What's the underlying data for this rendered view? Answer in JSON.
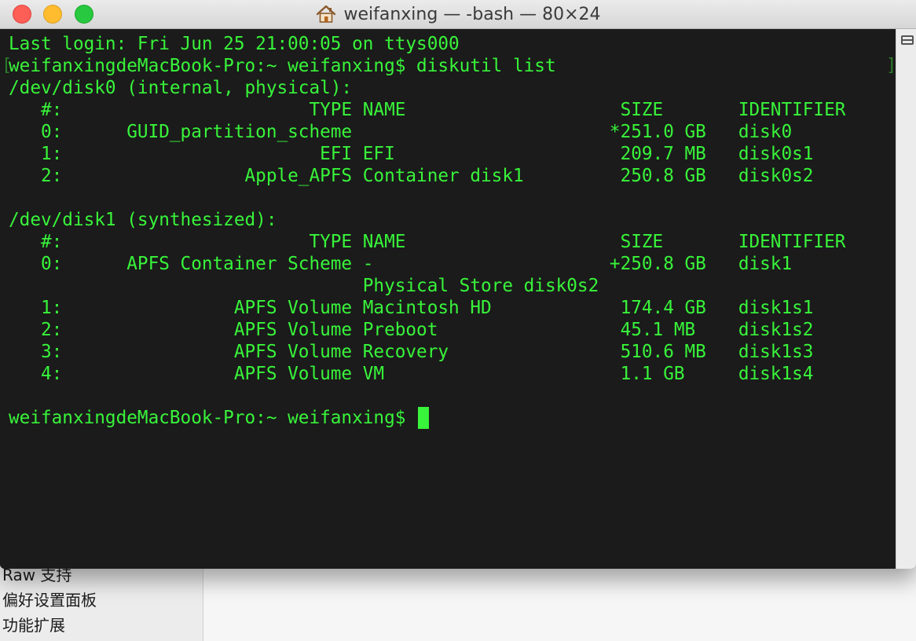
{
  "window": {
    "title": "weifanxing — -bash — 80×24",
    "title_icon": "home-icon"
  },
  "terminal": {
    "lines": [
      "Last login: Fri Jun 25 21:00:05 on ttys000",
      "weifanxingdeMacBook-Pro:~ weifanxing$ diskutil list",
      "/dev/disk0 (internal, physical):",
      "   #:                       TYPE NAME                    SIZE       IDENTIFIER",
      "   0:      GUID_partition_scheme                        *251.0 GB   disk0",
      "   1:                        EFI EFI                     209.7 MB   disk0s1",
      "   2:                 Apple_APFS Container disk1         250.8 GB   disk0s2",
      "",
      "/dev/disk1 (synthesized):",
      "   #:                       TYPE NAME                    SIZE       IDENTIFIER",
      "   0:      APFS Container Scheme -                      +250.8 GB   disk1",
      "                                 Physical Store disk0s2",
      "   1:                APFS Volume Macintosh HD            174.4 GB   disk1s1",
      "   2:                APFS Volume Preboot                 45.1 MB    disk1s2",
      "   3:                APFS Volume Recovery                510.6 MB   disk1s3",
      "   4:                APFS Volume VM                      1.1 GB     disk1s4",
      "",
      "weifanxingdeMacBook-Pro:~ weifanxing$ "
    ],
    "text_color": "#38f43a",
    "background_color": "#1b1b1b"
  },
  "background_app": {
    "sidebar_items": [
      "Raw 支持",
      "偏好设置面板",
      "功能扩展"
    ]
  }
}
